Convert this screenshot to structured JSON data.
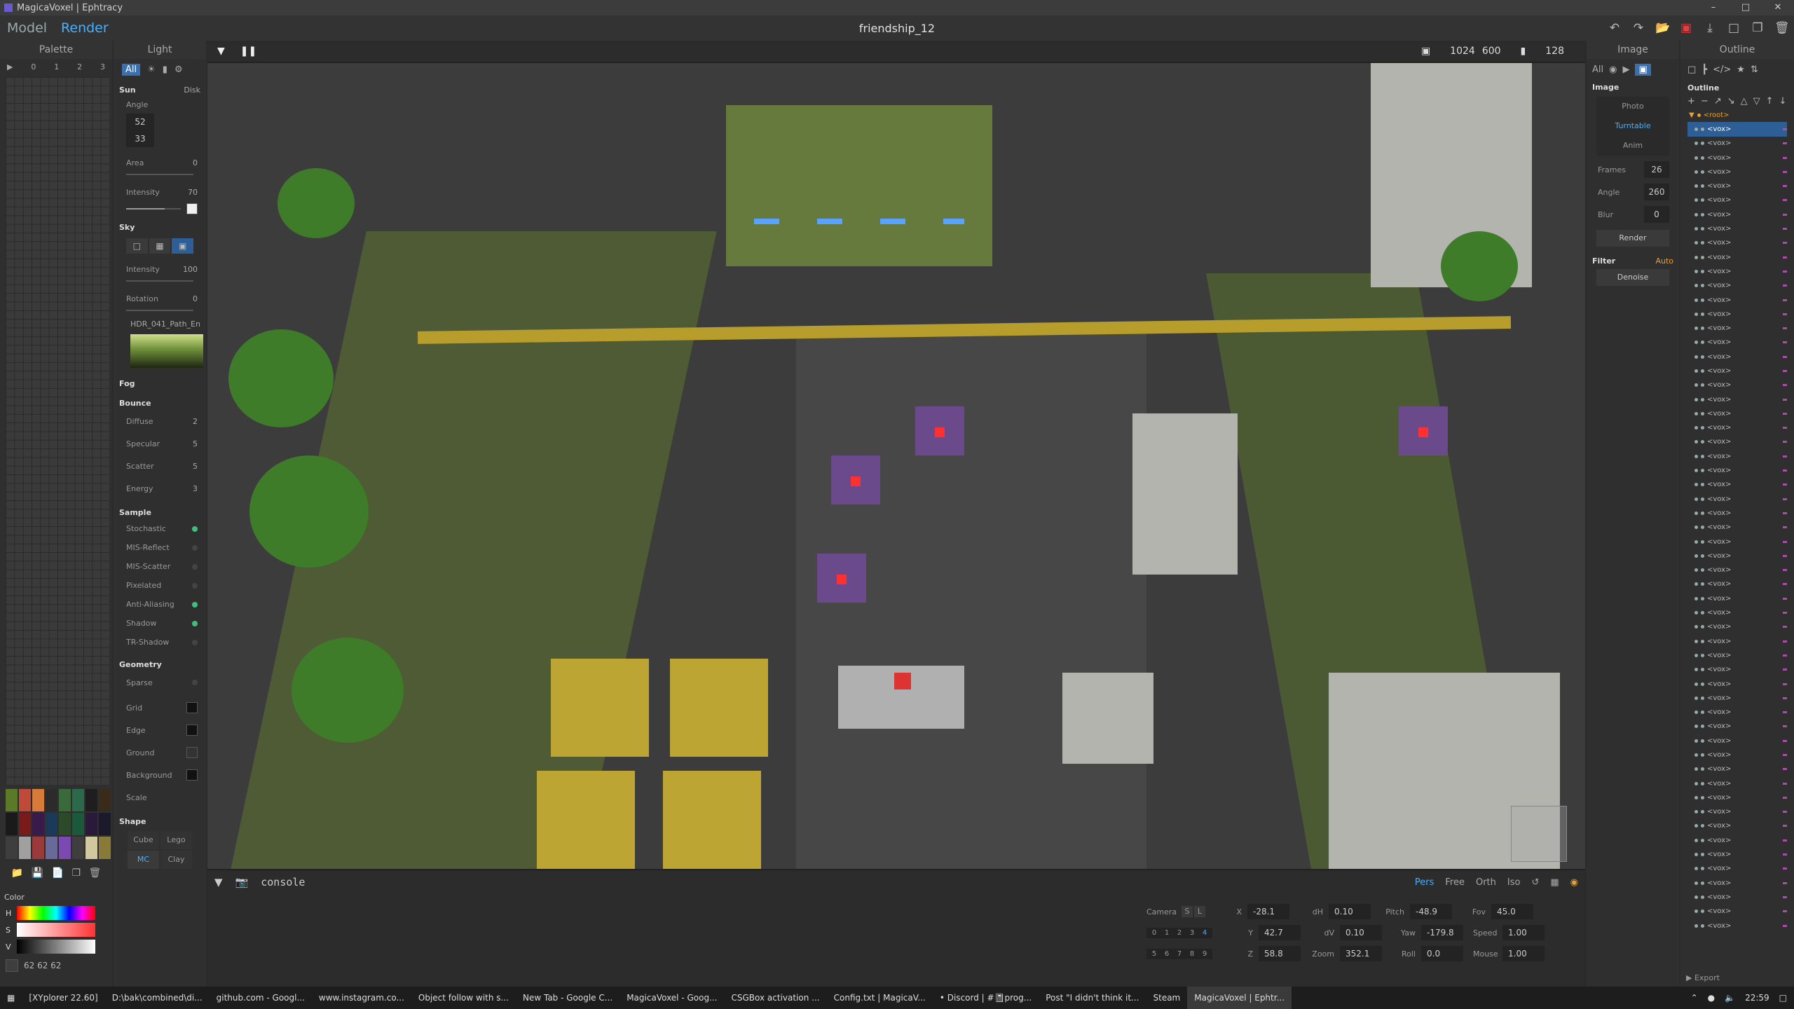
{
  "window": {
    "title": "MagicaVoxel | Ephtracy",
    "minimize": "–",
    "maximize": "□",
    "close": "✕"
  },
  "menubar": {
    "mode_model": "Model",
    "mode_render": "Render",
    "document_title": "friendship_12"
  },
  "palette": {
    "header": "Palette",
    "tabs": [
      "0",
      "1",
      "2",
      "3"
    ],
    "swatches": [
      "#5a7a2a",
      "#c04a3a",
      "#d77a3a",
      "#2b2b2b",
      "#3a6a3a",
      "#2a6a4a",
      "#1e1e1e",
      "#3a2a1a",
      "#1a1a1a",
      "#7a1a1a",
      "#3a1a4a",
      "#1a3a5a",
      "#2a4a2a",
      "#1a5a3a",
      "#2a1a3a",
      "#1a1a2a",
      "#3e3e3e",
      "#a0a0a0",
      "#9a3a3a",
      "#6a6a9a",
      "#7a4ab0",
      "#3e3e3e",
      "#d2c8a0",
      "#8a7a3a"
    ],
    "color_section": "Color",
    "h_label": "H",
    "s_label": "S",
    "v_label": "V",
    "rgb": "62  62  62"
  },
  "light": {
    "header": "Light",
    "tab_all": "All",
    "sun": {
      "title": "Sun",
      "disk": "Disk",
      "angle_label": "Angle",
      "angle_1": "52",
      "angle_2": "33",
      "area_label": "Area",
      "area_value": "0",
      "intensity_label": "Intensity",
      "intensity_value": "70",
      "intensity_fraction": 0.7
    },
    "sky": {
      "title": "Sky",
      "intensity_label": "Intensity",
      "intensity_value": "100",
      "rotation_label": "Rotation",
      "rotation_value": "0",
      "hdr_name": "HDR_041_Path_En"
    },
    "fog": "Fog",
    "bounce": {
      "title": "Bounce",
      "diffuse_label": "Diffuse",
      "diffuse": "2",
      "specular_label": "Specular",
      "specular": "5",
      "scatter_label": "Scatter",
      "scatter": "5",
      "energy_label": "Energy",
      "energy": "3"
    },
    "sample": {
      "title": "Sample",
      "items": [
        {
          "label": "Stochastic",
          "on": true
        },
        {
          "label": "MIS-Reflect",
          "on": false
        },
        {
          "label": "MIS-Scatter",
          "on": false
        },
        {
          "label": "Pixelated",
          "on": false
        },
        {
          "label": "Anti-Aliasing",
          "on": true
        },
        {
          "label": "Shadow",
          "on": true
        },
        {
          "label": "TR-Shadow",
          "on": false
        }
      ]
    },
    "geometry": {
      "title": "Geometry",
      "sparse": "Sparse"
    },
    "grid": "Grid",
    "edge": "Edge",
    "ground": "Ground",
    "background": "Background",
    "scale": "Scale",
    "shape": {
      "title": "Shape",
      "cube": "Cube",
      "lego": "Lego",
      "mc": "MC",
      "clay": "Clay"
    }
  },
  "viewport": {
    "width": "1024",
    "height": "600",
    "samples": "128"
  },
  "console": {
    "label": "console",
    "projection": [
      "Pers",
      "Free",
      "Orth",
      "Iso"
    ],
    "camera_label": "Camera",
    "camera_s": "S",
    "camera_l": "L",
    "slots_row1": [
      "0",
      "1",
      "2",
      "3",
      "4"
    ],
    "slots_row2": [
      "5",
      "6",
      "7",
      "8",
      "9"
    ],
    "x_label": "X",
    "x": "-28.1",
    "y_label": "Y",
    "y": "42.7",
    "z_label": "Z",
    "z": "58.8",
    "dh_label": "dH",
    "dh": "0.10",
    "dv_label": "dV",
    "dv": "0.10",
    "zoom_label": "Zoom",
    "zoom": "352.1",
    "pitch_label": "Pitch",
    "pitch": "-48.9",
    "yaw_label": "Yaw",
    "yaw": "-179.8",
    "roll_label": "Roll",
    "roll": "0.0",
    "fov_label": "Fov",
    "fov": "45.0",
    "speed_label": "Speed",
    "speed": "1.00",
    "mouse_label": "Mouse",
    "mouse": "1.00"
  },
  "image": {
    "header": "Image",
    "tab_all": "All",
    "section": "Image",
    "modes": [
      "Photo",
      "Turntable",
      "Anim"
    ],
    "frames_label": "Frames",
    "frames": "26",
    "angle_label": "Angle",
    "angle": "260",
    "blur_label": "Blur",
    "blur": "0",
    "render_button": "Render",
    "filter_label": "Filter",
    "filter_auto": "Auto",
    "denoise_button": "Denoise"
  },
  "outline": {
    "header": "Outline",
    "section": "Outline",
    "root": "<root>",
    "item_label": "<vox>",
    "item_count": 57,
    "export": "Export"
  },
  "taskbar": {
    "items": [
      "[XYplorer 22.60]",
      "D:\\bak\\combined\\di...",
      "github.com - Googl...",
      "www.instagram.co...",
      "Object follow with s...",
      "New Tab - Google C...",
      "MagicaVoxel - Goog...",
      "CSGBox activation ...",
      "Config.txt | MagicaV...",
      "• Discord | #📓prog...",
      "Post \"I didn't think it...",
      "Steam",
      "MagicaVoxel | Ephtr..."
    ],
    "active_index": 12,
    "clock": "22:59"
  }
}
